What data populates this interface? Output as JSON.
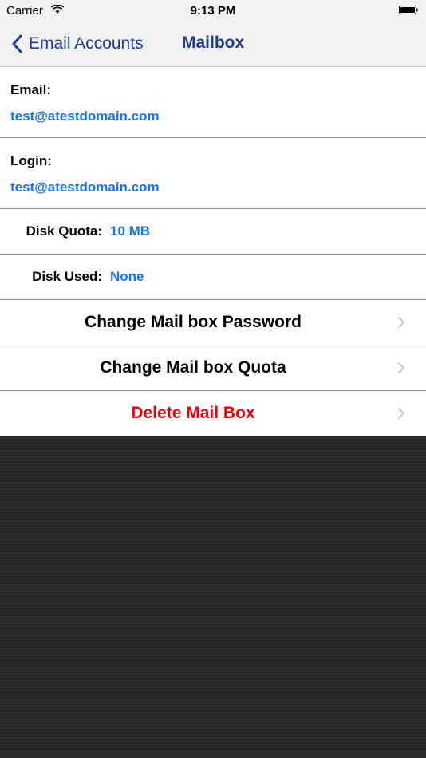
{
  "status": {
    "carrier": "Carrier",
    "time": "9:13 PM"
  },
  "nav": {
    "back_label": "Email Accounts",
    "title": "Mailbox"
  },
  "fields": [
    {
      "label": "Email:",
      "value": "test@atestdomain.com"
    },
    {
      "label": "Login:",
      "value": "test@atestdomain.com"
    }
  ],
  "details": [
    {
      "label": "Disk Quota:",
      "value": "10 MB"
    },
    {
      "label": "Disk Used:",
      "value": "None"
    }
  ],
  "actions": [
    {
      "label": "Change Mail box Password",
      "color": "#000000"
    },
    {
      "label": "Change Mail box Quota",
      "color": "#000000"
    },
    {
      "label": "Delete Mail Box",
      "color": "#e8000c"
    }
  ],
  "colors": {
    "nav_tint": "#1e3c8c",
    "value_blue": "#1a73e8",
    "destructive": "#e8000c"
  },
  "icons": {
    "back": "chevron-left-icon",
    "wifi": "wifi-icon",
    "battery": "battery-icon",
    "disclosure": "chevron-right-icon"
  }
}
